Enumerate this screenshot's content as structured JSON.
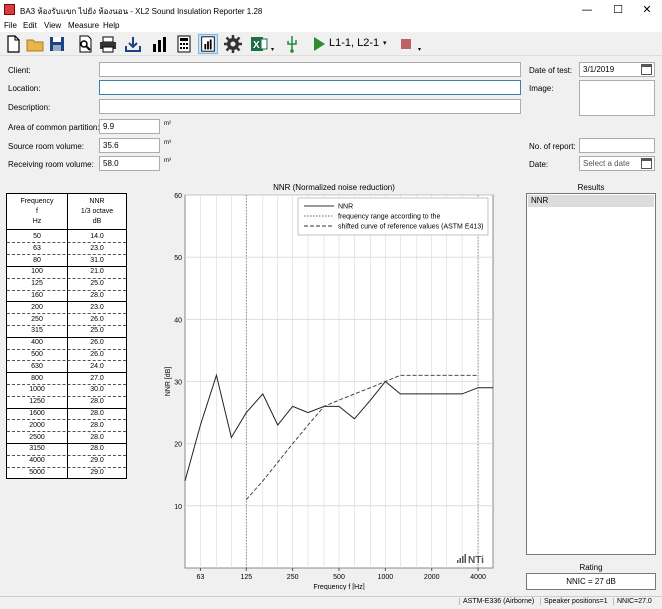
{
  "window": {
    "title": "BA3 ห้องรับแขก ไปยัง ห้องนอน - XL2 Sound Insulation Reporter 1.28",
    "min_glyph": "—",
    "max_glyph": "☐",
    "close_glyph": "✕"
  },
  "menu": [
    "File",
    "Edit",
    "View",
    "Measure",
    "Help"
  ],
  "toolbar": {
    "position_label": "L1-1, L2-1",
    "dropdown_glyph": "▾"
  },
  "form": {
    "client_label": "Client:",
    "client_value": "",
    "location_label": "Location:",
    "location_value": "",
    "description_label": "Description:",
    "description_value": "",
    "area_label": "Area of common partition:",
    "area_value": "9.9",
    "area_unit": "m²",
    "source_label": "Source room volume:",
    "source_value": "35.6",
    "source_unit": "m³",
    "receiving_label": "Receiving room volume:",
    "receiving_value": "58.0",
    "receiving_unit": "m³",
    "date_of_test_label": "Date of test:",
    "date_of_test_value": "3/1/2019",
    "image_label": "Image:",
    "no_report_label": "No. of report:",
    "no_report_value": "",
    "date_label": "Date:",
    "date_placeholder": "Select a date"
  },
  "table": {
    "col1_header": [
      "Frequency",
      "f",
      "Hz"
    ],
    "col2_header": [
      "NNR",
      "1/3 octave",
      "dB"
    ],
    "rows": [
      [
        "50",
        "14.0"
      ],
      [
        "63",
        "23.0"
      ],
      [
        "80",
        "31.0"
      ],
      [
        "100",
        "21.0"
      ],
      [
        "125",
        "25.0"
      ],
      [
        "160",
        "28.0"
      ],
      [
        "200",
        "23.0"
      ],
      [
        "250",
        "26.0"
      ],
      [
        "315",
        "25.0"
      ],
      [
        "400",
        "26.0"
      ],
      [
        "500",
        "26.0"
      ],
      [
        "630",
        "24.0"
      ],
      [
        "800",
        "27.0"
      ],
      [
        "1000",
        "30.0"
      ],
      [
        "1250",
        "28.0"
      ],
      [
        "1600",
        "28.0"
      ],
      [
        "2000",
        "28.0"
      ],
      [
        "2500",
        "28.0"
      ],
      [
        "3150",
        "28.0"
      ],
      [
        "4000",
        "29.0"
      ],
      [
        "5000",
        "29.0"
      ]
    ]
  },
  "chart_data": {
    "type": "line",
    "title": "NNR (Normalized noise reduction)",
    "xlabel": "Frequency f [Hz]",
    "ylabel": "NNR [dB]",
    "x_scale": "log",
    "xlim": [
      50,
      5000
    ],
    "ylim": [
      0,
      60
    ],
    "xticks": [
      63,
      125,
      250,
      500,
      1000,
      2000,
      4000
    ],
    "yticks": [
      10,
      20,
      30,
      40,
      50,
      60
    ],
    "grid": true,
    "legend_position": "top-right",
    "range_lines_x": [
      125,
      4000
    ],
    "series": [
      {
        "name": "NNR",
        "style": "solid",
        "x": [
          50,
          63,
          80,
          100,
          125,
          160,
          200,
          250,
          315,
          400,
          500,
          630,
          800,
          1000,
          1250,
          1600,
          2000,
          2500,
          3150,
          4000,
          5000
        ],
        "y": [
          14,
          23,
          31,
          21,
          25,
          28,
          23,
          26,
          25,
          26,
          26,
          24,
          27,
          30,
          28,
          28,
          28,
          28,
          28,
          29,
          29
        ]
      },
      {
        "name": "frequency range according to the",
        "style": "dotted",
        "x": [],
        "y": []
      },
      {
        "name": "shifted curve of reference values (ASTM E413)",
        "style": "dashed",
        "x": [
          125,
          160,
          200,
          250,
          315,
          400,
          500,
          630,
          800,
          1000,
          1250,
          1600,
          2000,
          2500,
          3150,
          4000
        ],
        "y": [
          11,
          14,
          17,
          20,
          23,
          26,
          27,
          28,
          29,
          30,
          31,
          31,
          31,
          31,
          31,
          31
        ]
      }
    ]
  },
  "results": {
    "title": "Results",
    "header": "NNR"
  },
  "rating": {
    "title": "Rating",
    "value": "NNIC = 27 dB"
  },
  "status": {
    "standard": "ASTM-E336 (Airborne)",
    "speaker": "Speaker positions=1",
    "nnic": "NNIC=27.0"
  },
  "colors": {
    "accent": "#3c7fb1",
    "play_green": "#2e8b2e",
    "stop_red": "#c06060",
    "grid": "#d8d8d8"
  }
}
